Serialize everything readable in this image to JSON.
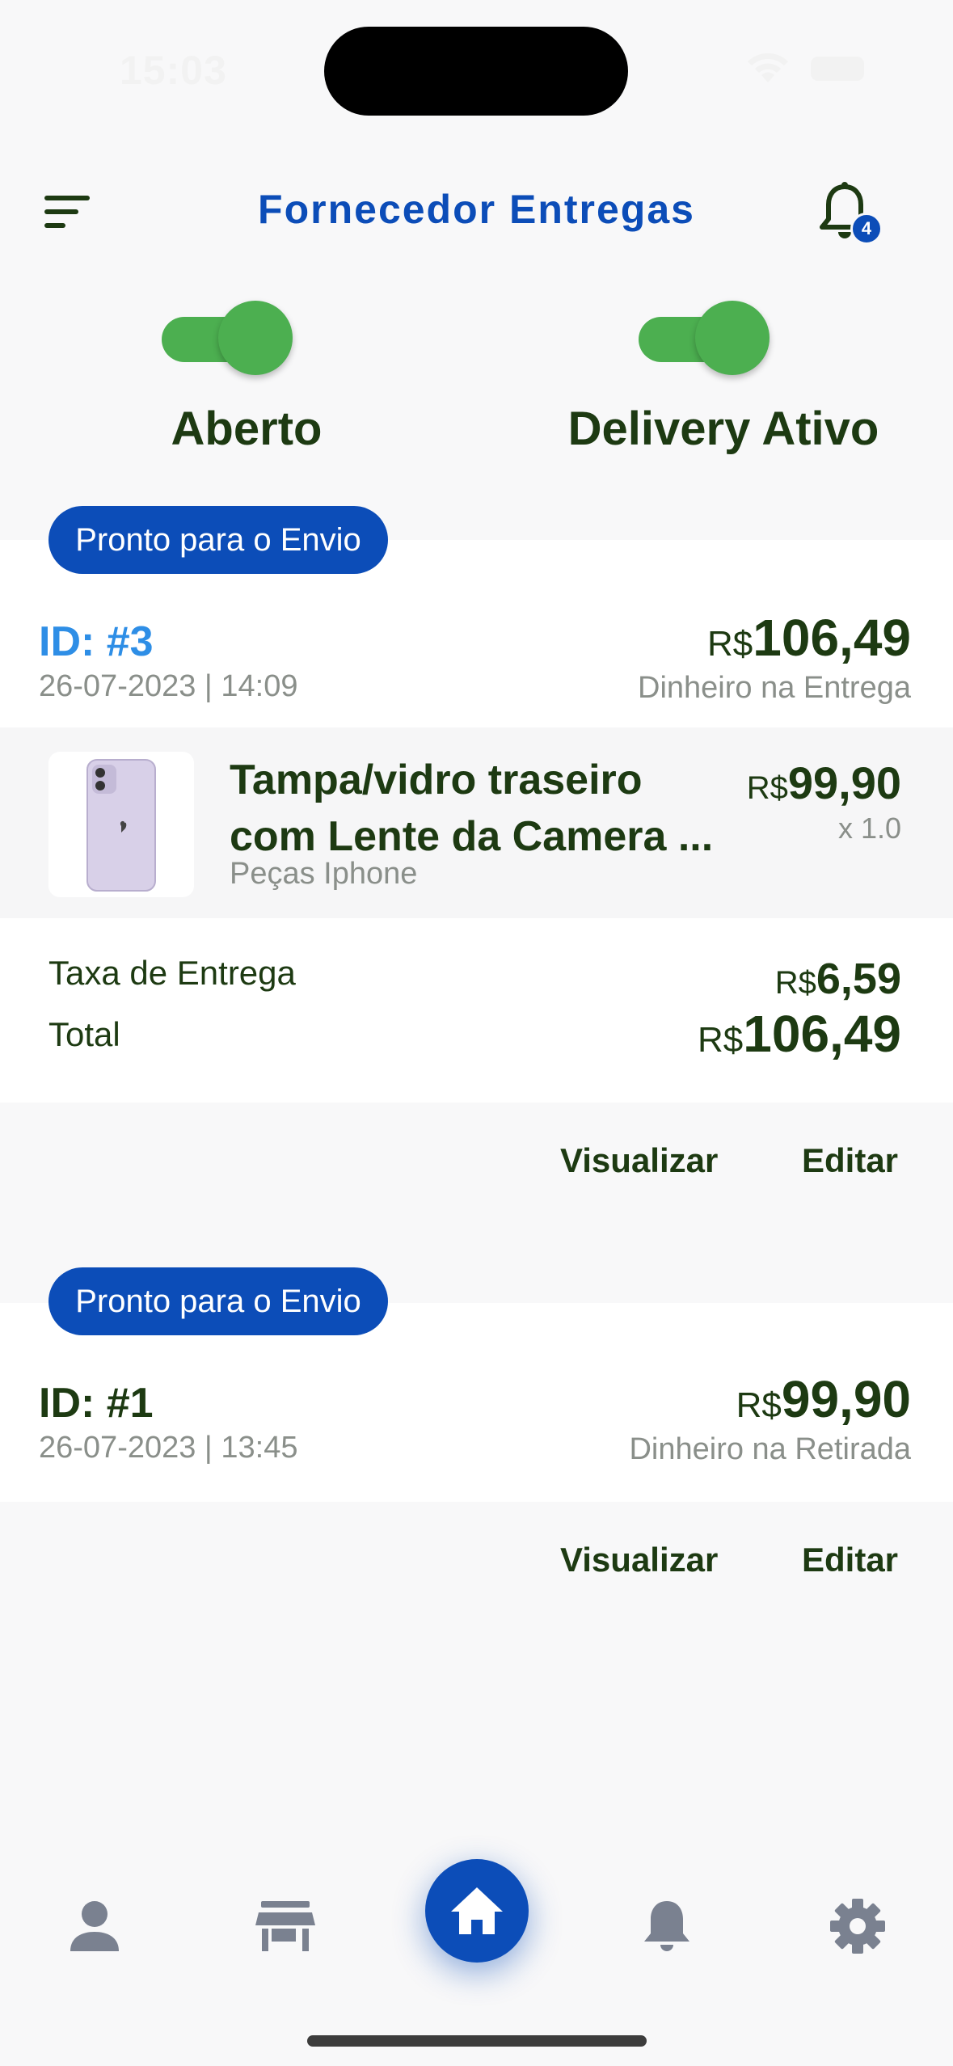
{
  "status_bar": {
    "time": "15:03"
  },
  "header": {
    "title": "Fornecedor Entregas",
    "notification_count": "4"
  },
  "toggles": [
    {
      "label": "Aberto",
      "on": true
    },
    {
      "label": "Delivery Ativo",
      "on": true
    }
  ],
  "orders": [
    {
      "status_pill": "Pronto para o Envio",
      "id": "ID: #3",
      "date": "26-07-2023 | 14:09",
      "currency": "R$",
      "total": "106,49",
      "payment": "Dinheiro na Entrega",
      "item": {
        "name_line1": "Tampa/vidro traseiro",
        "name_line2": "com Lente da Camera ...",
        "category": "Peças Iphone",
        "currency": "R$",
        "price": "99,90",
        "qty": "x 1.0"
      },
      "delivery_fee_label": "Taxa de Entrega",
      "delivery_fee": "6,59",
      "total_label": "Total",
      "summary_total": "106,49",
      "view_label": "Visualizar",
      "edit_label": "Editar"
    },
    {
      "status_pill": "Pronto para o Envio",
      "id": "ID: #1",
      "date": "26-07-2023 | 13:45",
      "currency": "R$",
      "total": "99,90",
      "payment": "Dinheiro na Retirada",
      "view_label": "Visualizar",
      "edit_label": "Editar"
    }
  ],
  "colors": {
    "brand_blue": "#0c4db8",
    "id_blue": "#2e8ee6",
    "toggle_green": "#4caf50",
    "dark_green_text": "#1d3a12",
    "nav_icon_gray": "#7a8190"
  },
  "bottom_nav": [
    {
      "icon": "person-icon"
    },
    {
      "icon": "store-icon"
    },
    {
      "icon": "home-icon",
      "active": true
    },
    {
      "icon": "bell-icon"
    },
    {
      "icon": "gear-icon"
    }
  ]
}
